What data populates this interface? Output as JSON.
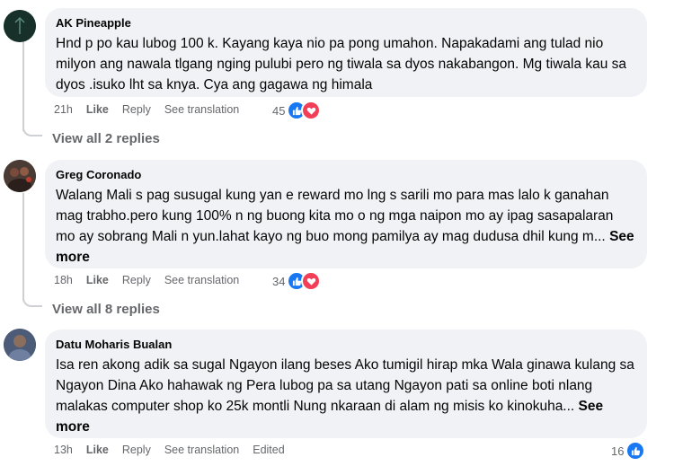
{
  "comments": [
    {
      "author": "AK Pineapple",
      "text": "Hnd p po kau lubog 100 k. Kayang kaya nio pa pong umahon. Napakadami ang tulad nio milyon ang nawala tlgang nging pulubi pero ng tiwala sa dyos nakabangon. Mg tiwala kau sa dyos .isuko lht sa knya. Cya ang gagawa ng himala",
      "see_more": "",
      "time": "21h",
      "like_label": "Like",
      "reply_label": "Reply",
      "translate_label": "See translation",
      "edited_label": "",
      "reaction_count": "45",
      "reactions": [
        "like-icon",
        "love-icon"
      ],
      "view_replies": "View all 2 replies"
    },
    {
      "author": "Greg Coronado",
      "text": "Walang Mali s pag susugal kung yan e reward mo lng s sarili mo para mas lalo k ganahan mag trabho.pero kung 100% n ng buong kita mo o ng mga naipon mo ay ipag sasapalaran mo ay sobrang Mali n yun.lahat kayo ng buo mong pamilya ay mag dudusa dhil kung m...",
      "see_more": "See more",
      "time": "18h",
      "like_label": "Like",
      "reply_label": "Reply",
      "translate_label": "See translation",
      "edited_label": "",
      "reaction_count": "34",
      "reactions": [
        "like-icon",
        "love-icon"
      ],
      "view_replies": "View all 8 replies"
    },
    {
      "author": "Datu Moharis Bualan",
      "text": "Isa ren akong adik sa sugal Ngayon ilang beses Ako tumigil hirap mka Wala ginawa kulang sa Ngayon Dina Ako hahawak ng Pera lubog pa sa utang Ngayon pati sa online boti nlang malakas computer shop ko 25k montli Nung nkaraan di alam ng misis ko kinokuha...",
      "see_more": "See more",
      "time": "13h",
      "like_label": "Like",
      "reply_label": "Reply",
      "translate_label": "See translation",
      "edited_label": "Edited",
      "reaction_count": "16",
      "reactions": [
        "like-icon"
      ],
      "view_replies": ""
    }
  ],
  "colors": {
    "bubble": "#f0f2f5",
    "secondary_text": "#65676b",
    "like_blue": "#1877f2",
    "love_red": "#f33e58"
  }
}
